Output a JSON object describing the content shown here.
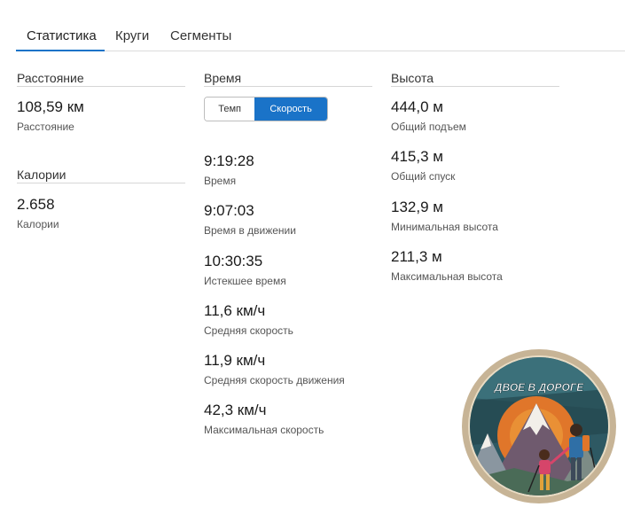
{
  "tabs": [
    {
      "label": "Статистика",
      "active": true
    },
    {
      "label": "Круги",
      "active": false
    },
    {
      "label": "Сегменты",
      "active": false
    }
  ],
  "distance": {
    "title": "Расстояние",
    "value": "108,59 км",
    "label": "Расстояние"
  },
  "calories": {
    "title": "Калории",
    "value": "2.658",
    "label": "Калории"
  },
  "time": {
    "title": "Время",
    "toggle": {
      "pace": "Темп",
      "speed": "Скорость",
      "selected": "speed"
    },
    "items": [
      {
        "value": "9:19:28",
        "label": "Время"
      },
      {
        "value": "9:07:03",
        "label": "Время в движении"
      },
      {
        "value": "10:30:35",
        "label": "Истекшее время"
      },
      {
        "value": "11,6 км/ч",
        "label": "Средняя скорость"
      },
      {
        "value": "11,9 км/ч",
        "label": "Средняя скорость движения"
      },
      {
        "value": "42,3 км/ч",
        "label": "Максимальная скорость"
      }
    ]
  },
  "elevation": {
    "title": "Высота",
    "items": [
      {
        "value": "444,0 м",
        "label": "Общий подъем"
      },
      {
        "value": "415,3 м",
        "label": "Общий спуск"
      },
      {
        "value": "132,9 м",
        "label": "Минимальная высота"
      },
      {
        "value": "211,3 м",
        "label": "Максимальная высота"
      }
    ]
  },
  "logo": {
    "text": "ДВОЕ В ДОРОГЕ"
  },
  "colors": {
    "accent": "#1a73c8",
    "logo_border": "#c7b496",
    "logo_sky": "#2e5963",
    "logo_sun": "#e0762a"
  }
}
